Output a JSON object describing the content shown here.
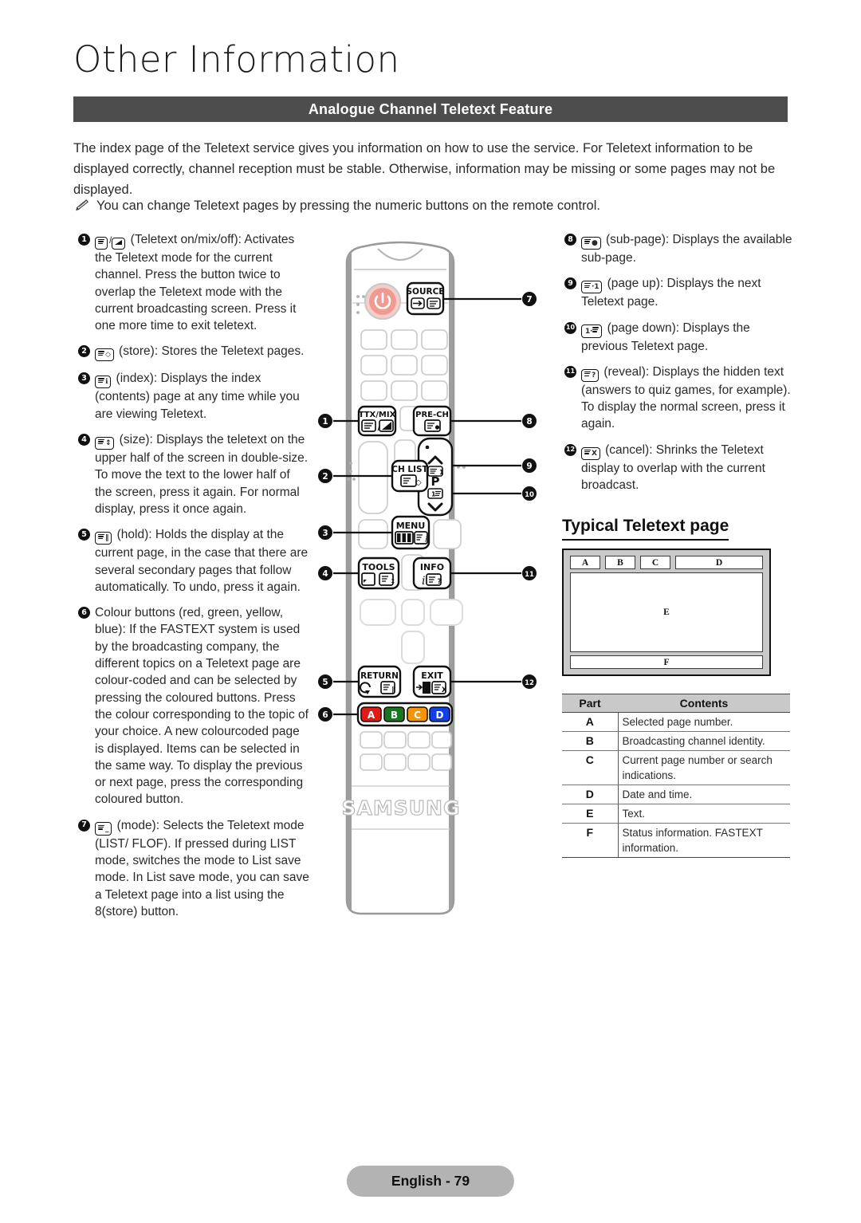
{
  "header": {
    "chapter_title": "Other Information",
    "section_band": "Analogue Channel Teletext Feature"
  },
  "intro": {
    "paragraph": "The index page of the Teletext service gives you information on how to use the service. For Teletext information to be displayed correctly, channel reception must be stable. Otherwise, information may be missing or some pages may not be displayed.",
    "note": "You can change Teletext pages by pressing the numeric buttons on the remote control.",
    "note_icon": "pencil-note-icon"
  },
  "left_column": [
    {
      "number": "1",
      "glyph": "teletext-on-mix-off-icon",
      "text": "(Teletext on/mix/off): Activates the Teletext mode for the current channel. Press the button twice to overlap the Teletext mode with the current broadcasting screen. Press it one more time to exit teletext."
    },
    {
      "number": "2",
      "glyph": "store-icon",
      "text": "(store): Stores the Teletext pages."
    },
    {
      "number": "3",
      "glyph": "index-icon",
      "text": "(index): Displays the index (contents) page at any time while you are viewing Teletext."
    },
    {
      "number": "4",
      "glyph": "size-icon",
      "text": "(size): Displays the teletext on the upper half of the screen in double-size. To move the text to the lower half of the screen, press it again. For normal display, press it once again."
    },
    {
      "number": "5",
      "glyph": "hold-icon",
      "text": "(hold): Holds the display at the current page, in the case that there are several secondary pages that follow automatically. To undo, press it again."
    },
    {
      "number": "6",
      "glyph": "",
      "text": "Colour buttons (red, green, yellow, blue): If the FASTEXT system is used by the broadcasting company, the different topics on a Teletext page are colour-coded and can be selected by pressing the coloured buttons. Press the colour corresponding to the topic of your choice. A new colourcoded page is displayed. Items can be selected in the same way. To display the previous or next page, press the corresponding coloured button."
    },
    {
      "number": "7",
      "glyph": "mode-icon",
      "text": "(mode): Selects the Teletext mode (LIST/ FLOF). If pressed during LIST mode, switches the mode to List save mode. In List save mode, you can save a Teletext page into a list using the 8(store) button."
    }
  ],
  "right_column": [
    {
      "number": "8",
      "glyph": "sub-page-icon",
      "text": "(sub-page): Displays the available sub-page."
    },
    {
      "number": "9",
      "glyph": "page-up-icon",
      "text": "(page up): Displays the next Teletext page."
    },
    {
      "number": "10",
      "glyph": "page-down-icon",
      "text": "(page down): Displays the previous Teletext page."
    },
    {
      "number": "11",
      "glyph": "reveal-icon",
      "text": "(reveal): Displays the hidden text (answers to quiz games, for example). To display the normal screen, press it again."
    },
    {
      "number": "12",
      "glyph": "cancel-icon",
      "text": "(cancel): Shrinks the Teletext display to overlap with the current broadcast."
    }
  ],
  "typical_page": {
    "heading": "Typical Teletext page",
    "diagram_labels": {
      "a": "A",
      "b": "B",
      "c": "C",
      "d": "D",
      "e": "E",
      "f": "F"
    }
  },
  "parts_table": {
    "headers": {
      "part": "Part",
      "contents": "Contents"
    },
    "rows": [
      {
        "part": "A",
        "contents": "Selected page number."
      },
      {
        "part": "B",
        "contents": "Broadcasting channel identity."
      },
      {
        "part": "C",
        "contents": "Current page number or search indications."
      },
      {
        "part": "D",
        "contents": "Date and time."
      },
      {
        "part": "E",
        "contents": "Text."
      },
      {
        "part": "F",
        "contents": "Status information. FASTEXT information."
      }
    ]
  },
  "remote": {
    "brand": "SAMSUNG",
    "buttons": {
      "source": "SOURCE",
      "pre_ch": "PRE-CH",
      "ttx_mix": "TTX/MIX",
      "ch_list": "CH LIST",
      "menu": "MENU",
      "tools": "TOOLS",
      "info": "INFO",
      "return": "RETURN",
      "exit": "EXIT",
      "p_label": "P"
    },
    "colour_buttons": [
      {
        "label": "A",
        "color": "#e01b17"
      },
      {
        "label": "B",
        "color": "#17761f"
      },
      {
        "label": "C",
        "color": "#f59406"
      },
      {
        "label": "D",
        "color": "#1140e8"
      }
    ],
    "callouts_left": [
      "1",
      "2",
      "3",
      "4",
      "5",
      "6"
    ],
    "callouts_right": [
      "7",
      "8",
      "9",
      "10",
      "11",
      "12"
    ]
  },
  "footer": {
    "page_label": "English - 79"
  },
  "colors": {
    "band_bg": "#4d4d4d",
    "diagram_frame": "#c9c9c9",
    "table_header_bg": "#c9c9c9",
    "footer_bg": "#b3b3b3",
    "power_button": "#f4a9a3"
  }
}
